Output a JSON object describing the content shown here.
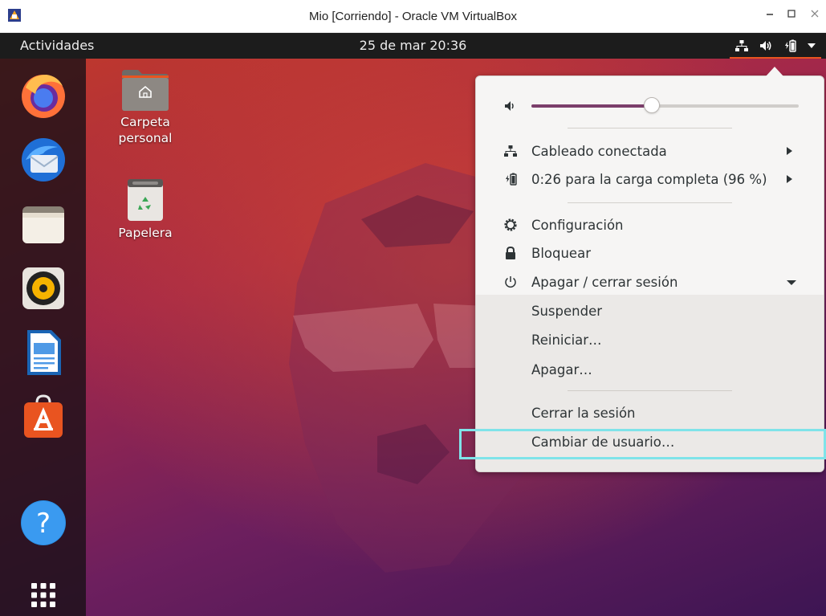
{
  "window": {
    "title": "Mio [Corriendo] - Oracle VM VirtualBox",
    "controls": {
      "minimize": "–",
      "maximize": "□",
      "close": "×"
    }
  },
  "topbar": {
    "activities": "Actividades",
    "clock": "25 de mar  20:36",
    "icons": [
      "network-wired-icon",
      "volume-icon",
      "battery-charging-icon",
      "dropdown-arrow-icon"
    ]
  },
  "dock": {
    "apps": [
      "firefox-icon",
      "thunderbird-icon",
      "files-icon",
      "rhythmbox-icon",
      "libreoffice-writer-icon",
      "software-center-icon",
      "help-icon",
      "show-applications-icon"
    ]
  },
  "desktop": {
    "icons": [
      {
        "label": "Carpeta personal",
        "label_lines": [
          "Carpeta",
          "personal"
        ],
        "icon": "home-folder-icon"
      },
      {
        "label": "Papelera",
        "label_lines": [
          "Papelera"
        ],
        "icon": "trash-icon"
      }
    ]
  },
  "menu": {
    "volume_level": 0.45,
    "items": {
      "network": "Cableado conectada",
      "battery": "0:26 para la carga completa (96 %)",
      "settings": "Configuración",
      "lock": "Bloquear",
      "power": "Apagar / cerrar sesión"
    },
    "submenu": {
      "suspend": "Suspender",
      "restart": "Reiniciar…",
      "poweroff": "Apagar…",
      "logout": "Cerrar la sesión",
      "switch_user": "Cambiar de usuario…"
    }
  },
  "colors": {
    "accent": "#E95420",
    "highlight": "#7fe3e9",
    "slider_fill": "#7b3e6b"
  }
}
